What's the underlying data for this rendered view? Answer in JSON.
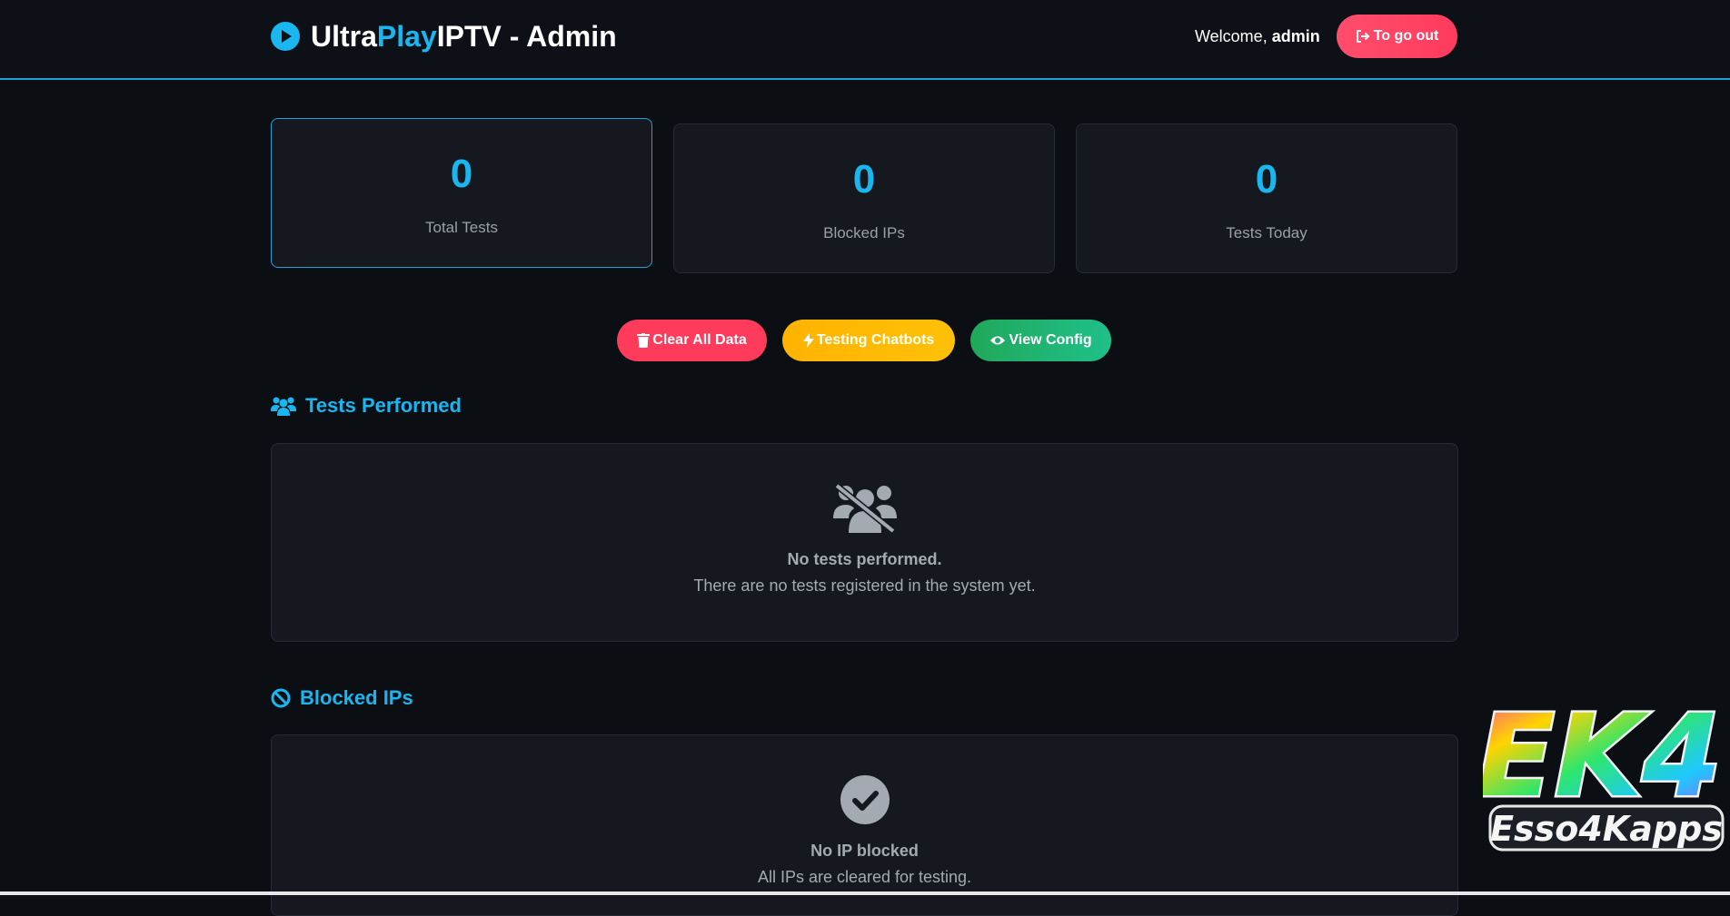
{
  "header": {
    "brand_part1": "Ultra",
    "brand_part2": "Play",
    "brand_part3": "IPTV - Admin",
    "welcome_prefix": "Welcome,",
    "username": "admin",
    "logout_label": "To go out"
  },
  "stats": [
    {
      "value": "0",
      "label": "Total Tests"
    },
    {
      "value": "0",
      "label": "Blocked IPs"
    },
    {
      "value": "0",
      "label": "Tests Today"
    }
  ],
  "actions": {
    "clear_label": "Clear All Data",
    "testing_label": "Testing Chatbots",
    "view_label": "View Config"
  },
  "tests_section": {
    "title": "Tests Performed",
    "empty_title": "No tests performed.",
    "empty_sub": "There are no tests registered in the system yet."
  },
  "blocked_section": {
    "title": "Blocked IPs",
    "empty_title": "No IP blocked",
    "empty_sub": "All IPs are cleared for testing."
  },
  "watermark": {
    "text_big": "EK4",
    "text_small": "Esso4Kapps"
  },
  "colors": {
    "accent": "#19b6f0",
    "logout": "#ff3b5c",
    "warning": "#ffc107",
    "success": "#20a85a",
    "background": "#0b0e13"
  },
  "icons": {
    "brand": "play-circle-icon",
    "logout": "sign-out-icon",
    "clear": "trash-icon",
    "testing": "bolt-icon",
    "view": "eye-icon",
    "tests_section": "users-icon",
    "blocked_section": "ban-icon",
    "tests_empty": "users-slash-icon",
    "blocked_empty": "check-circle-icon"
  }
}
